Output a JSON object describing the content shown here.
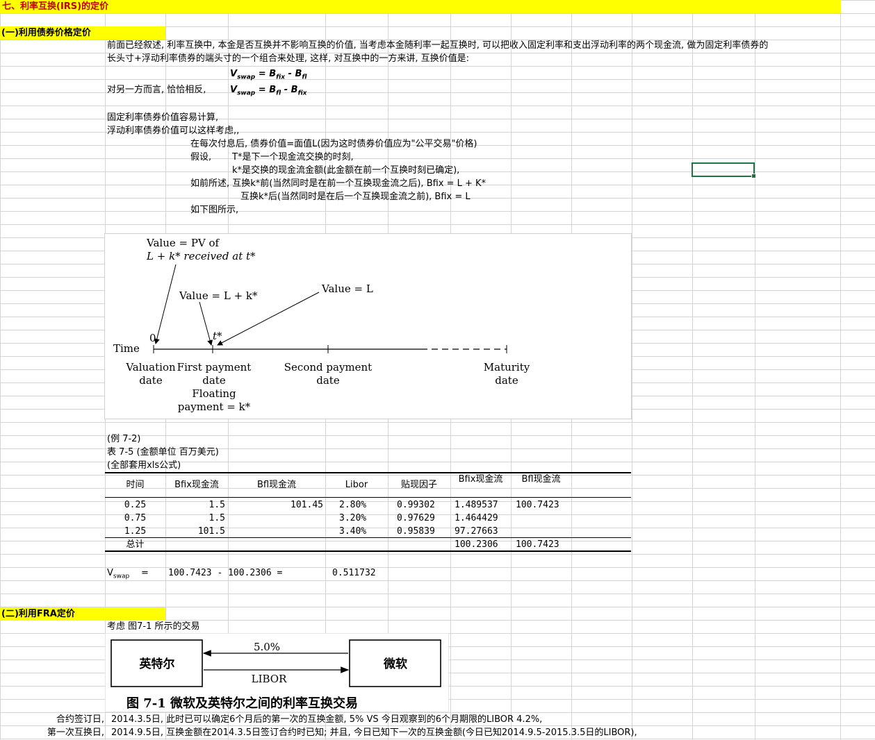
{
  "section_title": "七、利率互换(IRS)的定价",
  "part1": {
    "title": "(一)利用债券价格定价",
    "intro_line1": "前面已经叙述, 利率互换中, 本金是否互换并不影响互换的价值, 当考虑本金随利率一起互换时, 可以把收入固定利率和支出浮动利率的两个现金流, 做为固定利率债券的",
    "intro_line2": "长头寸+浮动利率债券的端头寸的一个组合来处理, 这样, 对互换中的一方来讲, 互换价值是:",
    "formula1": {
      "v": "V",
      "v_sub": "swap",
      "eq": " = ",
      "b1": "B",
      "b1_sub": "fix",
      "minus": " - ",
      "b2": "B",
      "b2_sub": "fl"
    },
    "other_side": "对另一方而言, 恰恰相反,",
    "formula2": {
      "v": "V",
      "v_sub": "swap",
      "eq": " = ",
      "b1": "B",
      "b1_sub": "fl",
      "minus": " - ",
      "b2": "B",
      "b2_sub": "fix"
    },
    "fixed_easy": "固定利率债券价值容易计算,",
    "floating_consider": "浮动利率债券价值可以这样考虑,,",
    "after_payment": "在每次付息后, 债券价值=面值L(因为这时债券价值应为\"公平交易\"价格)",
    "assume": "假设,",
    "t_star_def": "T*是下一个现金流交换的时刻,",
    "k_star_def": "k*是交换的现金流金额(此金额在前一个互换时刻已确定),",
    "before_k": "如前所述, 互换k*前(当然同时是在前一个互换现金流之后), Bfix = L  + K*",
    "after_k": "互换k*后(当然同时是在后一个互换现金流之前), Bfix = L",
    "as_shown": "如下图所示,"
  },
  "diagram1": {
    "value_pv_1": "Value = PV of",
    "value_pv_2": "L + k* received at t*",
    "value_lk": "Value = L + k*",
    "value_l": "Value = L",
    "zero": "0",
    "tstar": "t*",
    "time": "Time",
    "valuation_1": "Valuation",
    "valuation_2": "date",
    "first_1": "First payment",
    "first_2": "date",
    "floating_1": "Floating",
    "floating_2": "payment = k*",
    "second_1": "Second payment",
    "second_2": "date",
    "maturity_1": "Maturity",
    "maturity_2": "date"
  },
  "example": {
    "label": "(例 7-2)",
    "table_title": "表 7-5 (金额单位 百万美元)",
    "note": "(全部套用xls公式)",
    "headers": [
      "时间",
      "Bfix现金流",
      "Bfl现金流",
      "Libor",
      "贴现因子",
      "Bfix现金流",
      "Bfl现金流"
    ],
    "rows": [
      [
        "0.25",
        "1.5",
        "101.45",
        "2.80%",
        "0.99302",
        "1.489537",
        "100.7423"
      ],
      [
        "0.75",
        "1.5",
        "",
        "3.20%",
        "0.97629",
        "1.464429",
        ""
      ],
      [
        "1.25",
        "101.5",
        "",
        "3.40%",
        "0.95839",
        "97.27663",
        ""
      ]
    ],
    "total_label": "总计",
    "total_bfix": "100.2306",
    "total_bfl": "100.7423",
    "vswap_v": "V",
    "vswap_sub": "swap",
    "vswap_eq": "=",
    "vswap_expr": "100.7423 - 100.2306  =",
    "vswap_result": "0.511732"
  },
  "part2": {
    "title": "(二)利用FRA定价",
    "consider": "考虑 图7-1 所示的交易",
    "left_party": "英特尔",
    "right_party": "微软",
    "rate_top": "5.0%",
    "rate_bottom": "LIBOR",
    "figure_caption": "图 7-1    微软及英特尔之间的利率互换交易",
    "contract_label": "合约签订日,",
    "contract_text": "2014.3.5日, 此时已可以确定6个月后的第一次的互换金额, 5% VS 今日观察到的6个月期限的LIBOR 4.2%,",
    "first_swap_label": "第一次互换日,",
    "first_swap_text": "2014.9.5日, 互换金额在2014.3.5日签订合约时已知; 并且, 今日已知下一次的互换金额(今日已知2014.9.5-2015.3.5日的LIBOR),"
  }
}
